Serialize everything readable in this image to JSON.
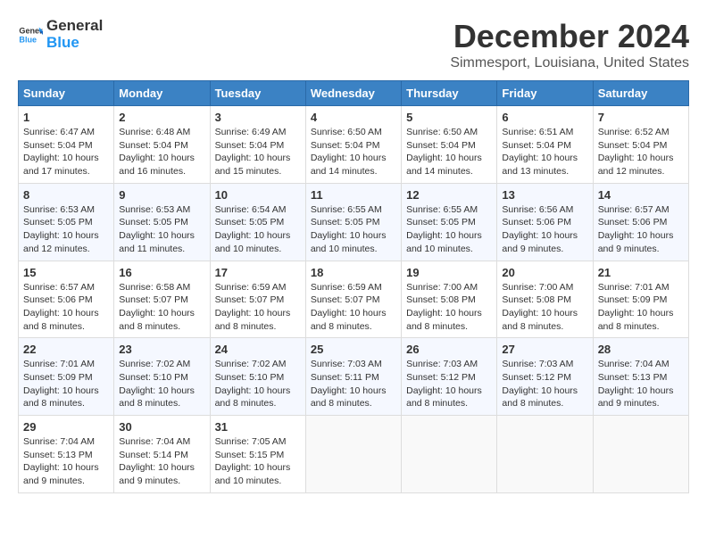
{
  "header": {
    "logo_general": "General",
    "logo_blue": "Blue",
    "month": "December 2024",
    "location": "Simmesport, Louisiana, United States"
  },
  "days_of_week": [
    "Sunday",
    "Monday",
    "Tuesday",
    "Wednesday",
    "Thursday",
    "Friday",
    "Saturday"
  ],
  "weeks": [
    [
      {
        "day": 1,
        "info": "Sunrise: 6:47 AM\nSunset: 5:04 PM\nDaylight: 10 hours and 17 minutes."
      },
      {
        "day": 2,
        "info": "Sunrise: 6:48 AM\nSunset: 5:04 PM\nDaylight: 10 hours and 16 minutes."
      },
      {
        "day": 3,
        "info": "Sunrise: 6:49 AM\nSunset: 5:04 PM\nDaylight: 10 hours and 15 minutes."
      },
      {
        "day": 4,
        "info": "Sunrise: 6:50 AM\nSunset: 5:04 PM\nDaylight: 10 hours and 14 minutes."
      },
      {
        "day": 5,
        "info": "Sunrise: 6:50 AM\nSunset: 5:04 PM\nDaylight: 10 hours and 14 minutes."
      },
      {
        "day": 6,
        "info": "Sunrise: 6:51 AM\nSunset: 5:04 PM\nDaylight: 10 hours and 13 minutes."
      },
      {
        "day": 7,
        "info": "Sunrise: 6:52 AM\nSunset: 5:04 PM\nDaylight: 10 hours and 12 minutes."
      }
    ],
    [
      {
        "day": 8,
        "info": "Sunrise: 6:53 AM\nSunset: 5:05 PM\nDaylight: 10 hours and 12 minutes."
      },
      {
        "day": 9,
        "info": "Sunrise: 6:53 AM\nSunset: 5:05 PM\nDaylight: 10 hours and 11 minutes."
      },
      {
        "day": 10,
        "info": "Sunrise: 6:54 AM\nSunset: 5:05 PM\nDaylight: 10 hours and 10 minutes."
      },
      {
        "day": 11,
        "info": "Sunrise: 6:55 AM\nSunset: 5:05 PM\nDaylight: 10 hours and 10 minutes."
      },
      {
        "day": 12,
        "info": "Sunrise: 6:55 AM\nSunset: 5:05 PM\nDaylight: 10 hours and 10 minutes."
      },
      {
        "day": 13,
        "info": "Sunrise: 6:56 AM\nSunset: 5:06 PM\nDaylight: 10 hours and 9 minutes."
      },
      {
        "day": 14,
        "info": "Sunrise: 6:57 AM\nSunset: 5:06 PM\nDaylight: 10 hours and 9 minutes."
      }
    ],
    [
      {
        "day": 15,
        "info": "Sunrise: 6:57 AM\nSunset: 5:06 PM\nDaylight: 10 hours and 8 minutes."
      },
      {
        "day": 16,
        "info": "Sunrise: 6:58 AM\nSunset: 5:07 PM\nDaylight: 10 hours and 8 minutes."
      },
      {
        "day": 17,
        "info": "Sunrise: 6:59 AM\nSunset: 5:07 PM\nDaylight: 10 hours and 8 minutes."
      },
      {
        "day": 18,
        "info": "Sunrise: 6:59 AM\nSunset: 5:07 PM\nDaylight: 10 hours and 8 minutes."
      },
      {
        "day": 19,
        "info": "Sunrise: 7:00 AM\nSunset: 5:08 PM\nDaylight: 10 hours and 8 minutes."
      },
      {
        "day": 20,
        "info": "Sunrise: 7:00 AM\nSunset: 5:08 PM\nDaylight: 10 hours and 8 minutes."
      },
      {
        "day": 21,
        "info": "Sunrise: 7:01 AM\nSunset: 5:09 PM\nDaylight: 10 hours and 8 minutes."
      }
    ],
    [
      {
        "day": 22,
        "info": "Sunrise: 7:01 AM\nSunset: 5:09 PM\nDaylight: 10 hours and 8 minutes."
      },
      {
        "day": 23,
        "info": "Sunrise: 7:02 AM\nSunset: 5:10 PM\nDaylight: 10 hours and 8 minutes."
      },
      {
        "day": 24,
        "info": "Sunrise: 7:02 AM\nSunset: 5:10 PM\nDaylight: 10 hours and 8 minutes."
      },
      {
        "day": 25,
        "info": "Sunrise: 7:03 AM\nSunset: 5:11 PM\nDaylight: 10 hours and 8 minutes."
      },
      {
        "day": 26,
        "info": "Sunrise: 7:03 AM\nSunset: 5:12 PM\nDaylight: 10 hours and 8 minutes."
      },
      {
        "day": 27,
        "info": "Sunrise: 7:03 AM\nSunset: 5:12 PM\nDaylight: 10 hours and 8 minutes."
      },
      {
        "day": 28,
        "info": "Sunrise: 7:04 AM\nSunset: 5:13 PM\nDaylight: 10 hours and 9 minutes."
      }
    ],
    [
      {
        "day": 29,
        "info": "Sunrise: 7:04 AM\nSunset: 5:13 PM\nDaylight: 10 hours and 9 minutes."
      },
      {
        "day": 30,
        "info": "Sunrise: 7:04 AM\nSunset: 5:14 PM\nDaylight: 10 hours and 9 minutes."
      },
      {
        "day": 31,
        "info": "Sunrise: 7:05 AM\nSunset: 5:15 PM\nDaylight: 10 hours and 10 minutes."
      },
      null,
      null,
      null,
      null
    ]
  ]
}
